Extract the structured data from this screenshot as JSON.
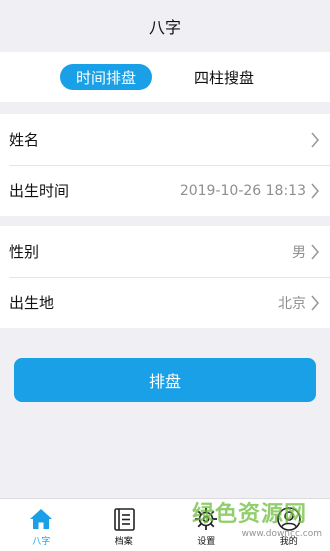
{
  "header": {
    "title": "八字"
  },
  "segments": [
    {
      "label": "时间排盘",
      "active": true
    },
    {
      "label": "四柱搜盘",
      "active": false
    }
  ],
  "form": {
    "name": {
      "label": "姓名",
      "value": ""
    },
    "birth_time": {
      "label": "出生时间",
      "value": "2019-10-26 18:13"
    },
    "gender": {
      "label": "性别",
      "value": "男"
    },
    "birthplace": {
      "label": "出生地",
      "value": "北京"
    }
  },
  "submit_label": "排盘",
  "tabbar": [
    {
      "label": "八字",
      "icon": "home-icon",
      "active": true
    },
    {
      "label": "档案",
      "icon": "archive-icon",
      "active": false
    },
    {
      "label": "设置",
      "icon": "settings-icon",
      "active": false
    },
    {
      "label": "我的",
      "icon": "user-icon",
      "active": false
    }
  ],
  "watermark": {
    "text": "绿色资源网",
    "url": "www.downcc.com"
  },
  "colors": {
    "accent": "#1aa0e6",
    "background": "#efeff4",
    "muted_text": "#8e8e93"
  }
}
